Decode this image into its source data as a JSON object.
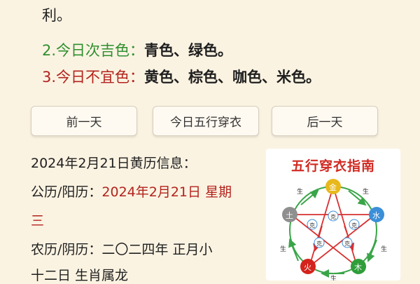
{
  "advice": {
    "line1_text": "利。",
    "line2_label": "2.今日次吉色：",
    "line2_colors": "青色、绿色。",
    "line3_label": "3.今日不宜色：",
    "line3_colors": "黄色、棕色、咖色、米色。"
  },
  "nav": {
    "prev_label": "前一天",
    "today_label": "今日五行穿衣",
    "next_label": "后一天"
  },
  "almanac": {
    "heading": "2024年2月21日黄历信息：",
    "solar_label": "公历/阳历：",
    "solar_value_1": "2024年2月21日 星期",
    "solar_value_2": "三",
    "lunar_label": "农历/阴历：",
    "lunar_value_1": "二〇二四年 正月小",
    "lunar_value_2": "十二日 生肖属龙"
  },
  "guide": {
    "title": "五行穿衣指南",
    "elements": {
      "fire_top": "金",
      "water": "水",
      "wood": "木",
      "fire": "火",
      "earth": "土"
    },
    "generate": "生",
    "overcome": "克",
    "colors": {
      "top": "#e8b81c",
      "water": "#3a8fd8",
      "wood": "#2f9e3a",
      "fire": "#d4231c",
      "earth": "#8f8f8f",
      "generate_arrow": "#3aa548",
      "overcome_arrow": "#d83030"
    }
  }
}
